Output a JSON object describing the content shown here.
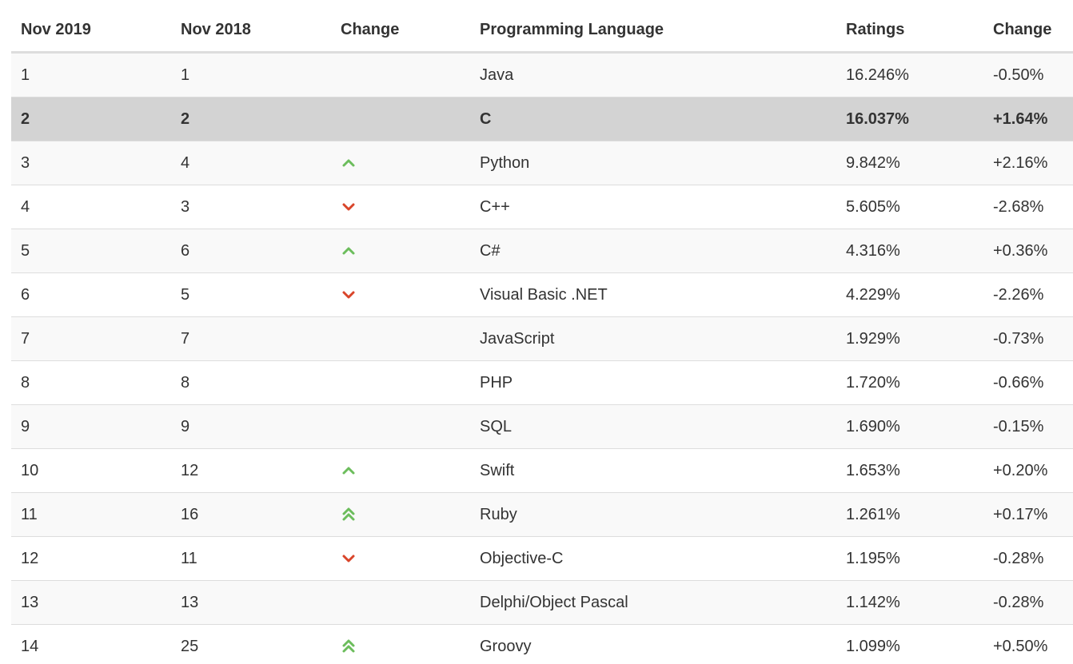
{
  "headers": [
    "Nov 2019",
    "Nov 2018",
    "Change",
    "Programming Language",
    "Ratings",
    "Change"
  ],
  "colors": {
    "up": "#6cbd5c",
    "down": "#d9452a",
    "highlight_row": "#d3d3d3",
    "stripe": "#f9f9f9"
  },
  "rows": [
    {
      "rank_2019": "1",
      "rank_2018": "1",
      "trend": "none",
      "language": "Java",
      "rating": "16.246%",
      "change": "-0.50%",
      "highlight": false
    },
    {
      "rank_2019": "2",
      "rank_2018": "2",
      "trend": "none",
      "language": "C",
      "rating": "16.037%",
      "change": "+1.64%",
      "highlight": true
    },
    {
      "rank_2019": "3",
      "rank_2018": "4",
      "trend": "up",
      "language": "Python",
      "rating": "9.842%",
      "change": "+2.16%",
      "highlight": false
    },
    {
      "rank_2019": "4",
      "rank_2018": "3",
      "trend": "down",
      "language": "C++",
      "rating": "5.605%",
      "change": "-2.68%",
      "highlight": false
    },
    {
      "rank_2019": "5",
      "rank_2018": "6",
      "trend": "up",
      "language": "C#",
      "rating": "4.316%",
      "change": "+0.36%",
      "highlight": false
    },
    {
      "rank_2019": "6",
      "rank_2018": "5",
      "trend": "down",
      "language": "Visual Basic .NET",
      "rating": "4.229%",
      "change": "-2.26%",
      "highlight": false
    },
    {
      "rank_2019": "7",
      "rank_2018": "7",
      "trend": "none",
      "language": "JavaScript",
      "rating": "1.929%",
      "change": "-0.73%",
      "highlight": false
    },
    {
      "rank_2019": "8",
      "rank_2018": "8",
      "trend": "none",
      "language": "PHP",
      "rating": "1.720%",
      "change": "-0.66%",
      "highlight": false
    },
    {
      "rank_2019": "9",
      "rank_2018": "9",
      "trend": "none",
      "language": "SQL",
      "rating": "1.690%",
      "change": "-0.15%",
      "highlight": false
    },
    {
      "rank_2019": "10",
      "rank_2018": "12",
      "trend": "up",
      "language": "Swift",
      "rating": "1.653%",
      "change": "+0.20%",
      "highlight": false
    },
    {
      "rank_2019": "11",
      "rank_2018": "16",
      "trend": "upup",
      "language": "Ruby",
      "rating": "1.261%",
      "change": "+0.17%",
      "highlight": false
    },
    {
      "rank_2019": "12",
      "rank_2018": "11",
      "trend": "down",
      "language": "Objective-C",
      "rating": "1.195%",
      "change": "-0.28%",
      "highlight": false
    },
    {
      "rank_2019": "13",
      "rank_2018": "13",
      "trend": "none",
      "language": "Delphi/Object Pascal",
      "rating": "1.142%",
      "change": "-0.28%",
      "highlight": false
    },
    {
      "rank_2019": "14",
      "rank_2018": "25",
      "trend": "upup",
      "language": "Groovy",
      "rating": "1.099%",
      "change": "+0.50%",
      "highlight": false
    }
  ]
}
